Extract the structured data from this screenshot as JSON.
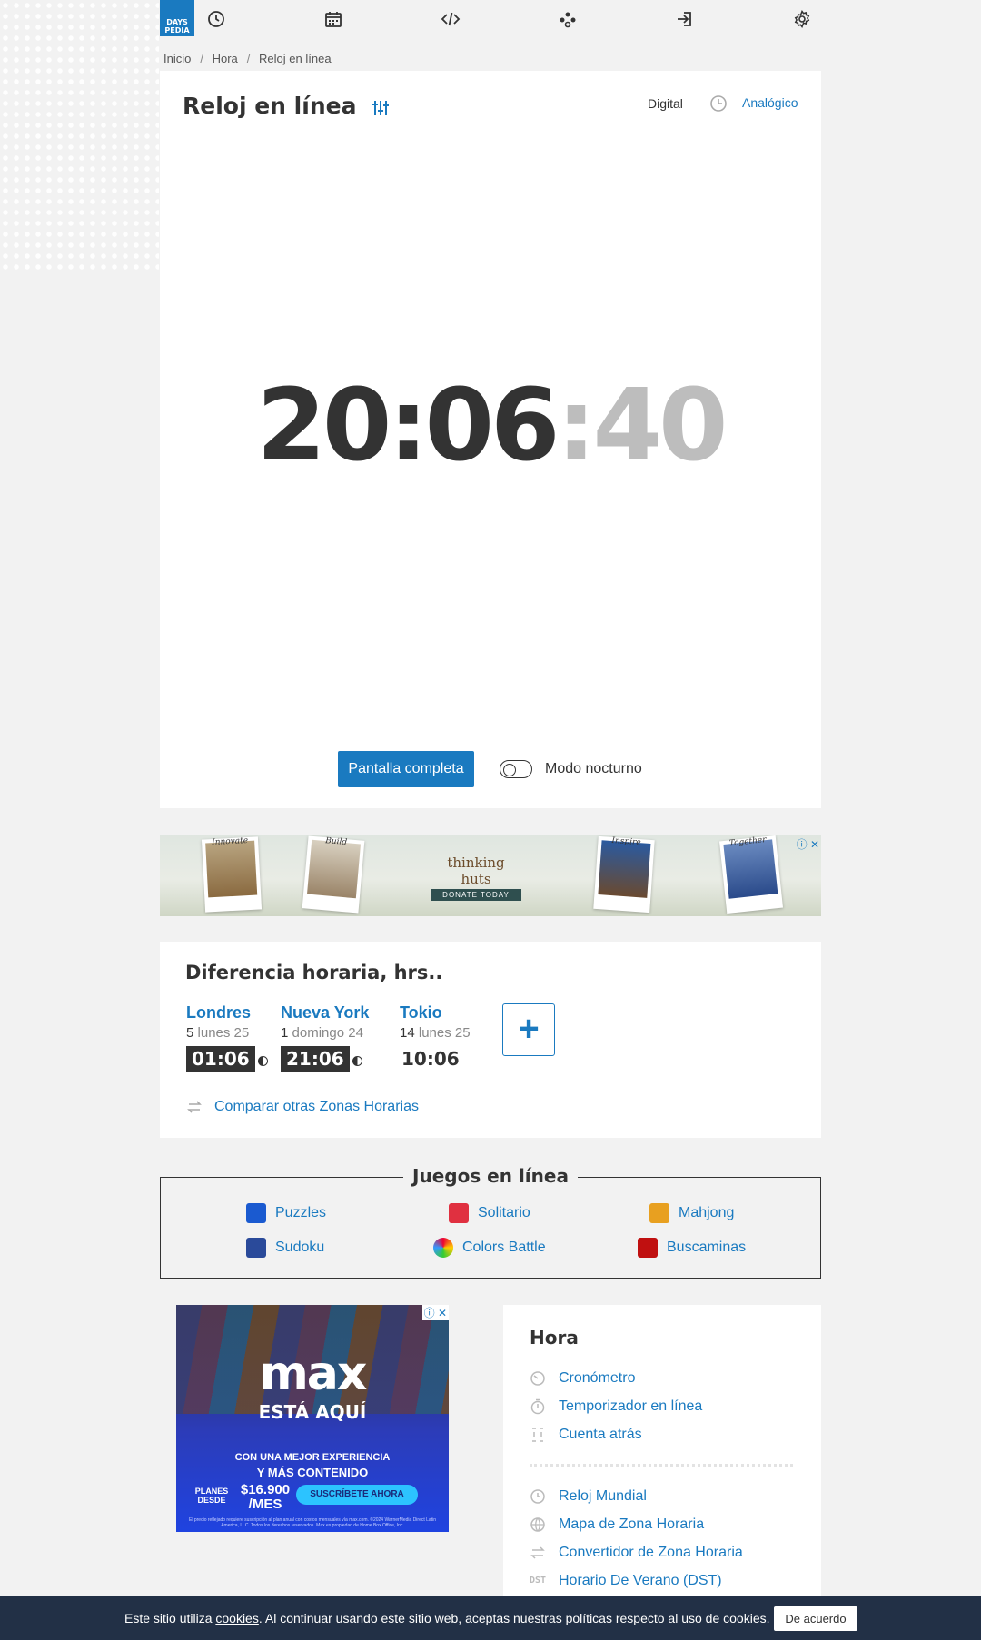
{
  "logo": {
    "line1": "DAYS",
    "line2": "PEDIA"
  },
  "nav": [
    "clock-icon",
    "calendar-icon",
    "code-icon",
    "network-icon",
    "login-icon",
    "gear-icon"
  ],
  "breadcrumb": [
    "Inicio",
    "Hora",
    "Reloj en línea"
  ],
  "clock": {
    "title": "Reloj en línea",
    "mode_digital": "Digital",
    "mode_analog": "Analógico",
    "time_hm": "20:06",
    "time_sec": ":40",
    "fullscreen_label": "Pantalla completa",
    "night_mode_label": "Modo nocturno"
  },
  "banner_ad": {
    "brand": "thinking huts",
    "donate": "DONATE TODAY",
    "captions": [
      "Innovate",
      "Build",
      "Inspire",
      "Together"
    ]
  },
  "timezones": {
    "title": "Diferencia horaria, hrs..",
    "cities": [
      {
        "name": "Londres",
        "offset": "5",
        "date": "lunes 25",
        "time": "01:06"
      },
      {
        "name": "Nueva York",
        "offset": "1",
        "date": "domingo 24",
        "time": "21:06"
      },
      {
        "name": "Tokio",
        "offset": "14",
        "date": "lunes 25",
        "time": "10:06"
      }
    ],
    "add_label": "+",
    "compare_label": "Comparar otras Zonas Horarias"
  },
  "games": {
    "title": "Juegos en línea",
    "items": [
      "Puzzles",
      "Solitario",
      "Mahjong",
      "Sudoku",
      "Colors Battle",
      "Buscaminas"
    ]
  },
  "max_ad": {
    "logo": "max",
    "headline": "ESTÁ AQUÍ",
    "line1": "CON UNA MEJOR EXPERIENCIA",
    "line2": "Y MÁS CONTENIDO",
    "plans": "PLANES DESDE",
    "price": "$16.900 /MES",
    "cta": "SUSCRÍBETE AHORA",
    "fine": "El precio reflejado requiere suscripción al plan anual con costos mensuales vía max.com. ©2024 WarnerMedia Direct Latin America, LLC. Todos los derechos reservados. Max es propiedad de Home Box Office, Inc."
  },
  "sidebar": {
    "title": "Hora",
    "group1": [
      "Cronómetro",
      "Temporizador en línea",
      "Cuenta atrás"
    ],
    "group2": [
      "Reloj Mundial",
      "Mapa de Zona Horaria",
      "Convertidor de Zona Horaria",
      "Horario De Verano (DST)"
    ],
    "dst_abbr": "DST"
  },
  "cookie": {
    "before": "Este sitio utiliza ",
    "link": "cookies",
    "after": ". Al continuar usando este sitio web, aceptas nuestras políticas respecto al uso de cookies.",
    "accept": "De acuerdo"
  },
  "colors": {
    "accent": "#1a7ac0",
    "dark": "#333333",
    "cookie_bg": "#223046"
  }
}
